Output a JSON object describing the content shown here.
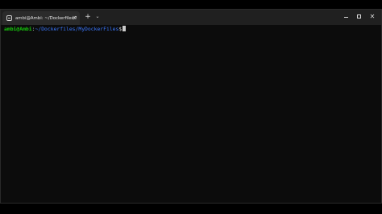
{
  "tab": {
    "title": "ambi@Ambi: ~/Dockerfiles/M",
    "icon": "terminal-icon",
    "close_glyph": "×"
  },
  "toolbar": {
    "new_tab_glyph": "+",
    "dropdown_glyph": "⌄"
  },
  "window_controls": {
    "close_glyph": "✕"
  },
  "terminal": {
    "user_host": "ambi@Ambi",
    "colon": ":",
    "path": "~/Dockerfiles/MyDockerFiles",
    "symbol": "$"
  },
  "colors": {
    "prompt_user": "#16c60c",
    "prompt_path": "#3b78ff",
    "background": "#0c0c0c",
    "titlebar": "#202020"
  }
}
